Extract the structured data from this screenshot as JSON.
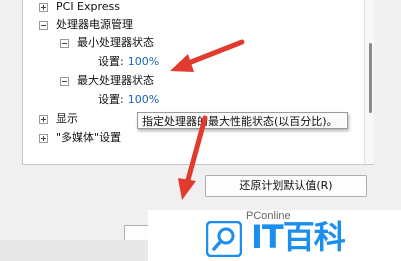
{
  "tree": {
    "items": [
      {
        "label": "PCI Express",
        "expander": "plus"
      },
      {
        "label": "处理器电源管理",
        "expander": "minus"
      },
      {
        "label": "最小处理器状态",
        "expander": "minus"
      },
      {
        "label": "设置:",
        "value": "100%"
      },
      {
        "label": "最大处理器状态",
        "expander": "minus"
      },
      {
        "label": "设置:",
        "value": "100%"
      },
      {
        "label": "显示",
        "expander": "plus"
      },
      {
        "label": "\"多媒体\"设置",
        "expander": "plus"
      }
    ]
  },
  "tooltip": {
    "text": "指定处理器的最大性能状态(以百分比)。"
  },
  "buttons": {
    "restore_defaults": "还原计划默认值(R)"
  },
  "watermark": {
    "pconline": "PConline",
    "brand": "IT百科",
    "accent": "#1b8ff0"
  },
  "annotation": {
    "arrow_color": "#e23b2e"
  }
}
